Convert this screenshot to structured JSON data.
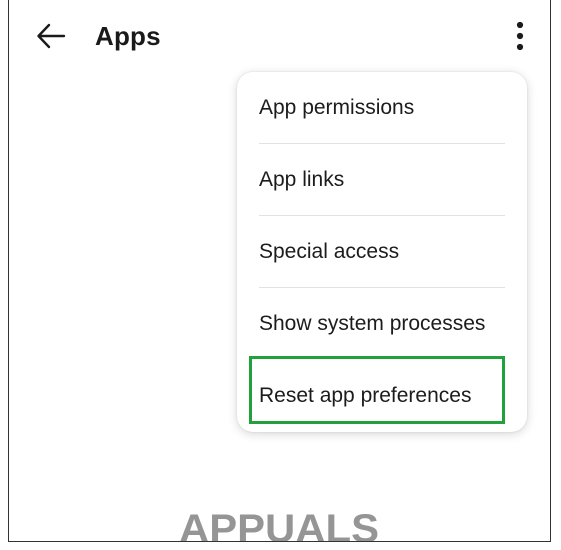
{
  "header": {
    "title": "Apps",
    "back_icon": "arrow-left-icon",
    "more_icon": "more-vert-icon"
  },
  "menu": {
    "items": [
      {
        "label": "App permissions"
      },
      {
        "label": "App links"
      },
      {
        "label": "Special access"
      },
      {
        "label": "Show system processes"
      },
      {
        "label": "Reset app preferences",
        "highlighted": true
      }
    ]
  },
  "watermark": {
    "text": "APPUALS"
  },
  "colors": {
    "highlight": "#22a03c",
    "text": "#1c1c1c",
    "watermark": "#8a8a8a"
  }
}
